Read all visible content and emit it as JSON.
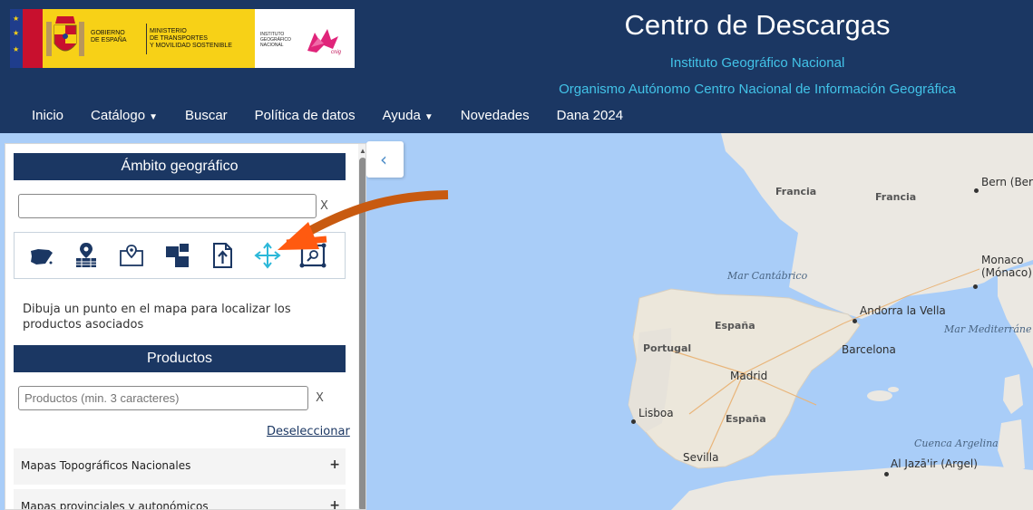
{
  "header": {
    "logo": {
      "gobierno": "GOBIERNO\nDE ESPAÑA",
      "ministerio_line1": "MINISTERIO",
      "ministerio_line2": "DE TRANSPORTES",
      "ministerio_line3": "Y MOVILIDAD SOSTENIBLE",
      "instituto": "INSTITUTO\nGEOGRÁFICO\nNACIONAL",
      "cnig_mark": "cnig"
    },
    "title": "Centro de Descargas",
    "subtitle1": "Instituto Geográfico Nacional",
    "subtitle2": "Organismo Autónomo Centro Nacional de Información Geográfica"
  },
  "nav": {
    "items": [
      {
        "label": "Inicio",
        "dropdown": false
      },
      {
        "label": "Catálogo",
        "dropdown": true
      },
      {
        "label": "Buscar",
        "dropdown": false
      },
      {
        "label": "Política de datos",
        "dropdown": false
      },
      {
        "label": "Ayuda",
        "dropdown": true
      },
      {
        "label": "Novedades",
        "dropdown": false
      },
      {
        "label": "Dana 2024",
        "dropdown": false
      }
    ],
    "caret": "▼"
  },
  "panel": {
    "ambito": {
      "title": "Ámbito geográfico",
      "search_value": "",
      "clear": "X",
      "tools": [
        {
          "icon": "spain-map-icon"
        },
        {
          "icon": "municipality-marker-icon"
        },
        {
          "icon": "map-point-icon"
        },
        {
          "icon": "sheet-grid-icon"
        },
        {
          "icon": "upload-file-icon"
        },
        {
          "icon": "move-arrows-icon",
          "active": true
        },
        {
          "icon": "search-extent-icon"
        }
      ],
      "help": "Dibuja un punto en el mapa para localizar los productos asociados"
    },
    "productos": {
      "title": "Productos",
      "placeholder": "Productos (min. 3 caracteres)",
      "clear": "X",
      "deselect": "Deseleccionar",
      "categories": [
        {
          "label": "Mapas Topográficos Nacionales",
          "expander": "+"
        },
        {
          "label": "Mapas provinciales y autonómicos",
          "expander": "+"
        }
      ]
    },
    "collapse_icon": "‹"
  },
  "map": {
    "labels": [
      {
        "text": "Francia",
        "kind": "country"
      },
      {
        "text": "Francia",
        "kind": "country"
      },
      {
        "text": "Bern (Bern)",
        "kind": "city"
      },
      {
        "text": "Mar Cantábrico",
        "kind": "sea"
      },
      {
        "text": "Monaco",
        "kind": "city"
      },
      {
        "text": "(Mónaco)",
        "kind": "city"
      },
      {
        "text": "Andorra la Vella",
        "kind": "city"
      },
      {
        "text": "España",
        "kind": "country"
      },
      {
        "text": "Portugal",
        "kind": "country"
      },
      {
        "text": "Barcelona",
        "kind": "city"
      },
      {
        "text": "Mar Mediterráne",
        "kind": "sea"
      },
      {
        "text": "Madrid",
        "kind": "city"
      },
      {
        "text": "Lisboa",
        "kind": "city"
      },
      {
        "text": "España",
        "kind": "country"
      },
      {
        "text": "Cuenca Argelina",
        "kind": "sea"
      },
      {
        "text": "Sevilla",
        "kind": "city"
      },
      {
        "text": "Al Jazā'ir (Argel)",
        "kind": "city"
      }
    ],
    "colors": {
      "water": "#a9cdf8",
      "land": "#eae6df",
      "spain": "#ece8dc"
    }
  },
  "annotation": {
    "arrow_color": "#c85a10",
    "active_tool_color": "#2bb8d9"
  }
}
